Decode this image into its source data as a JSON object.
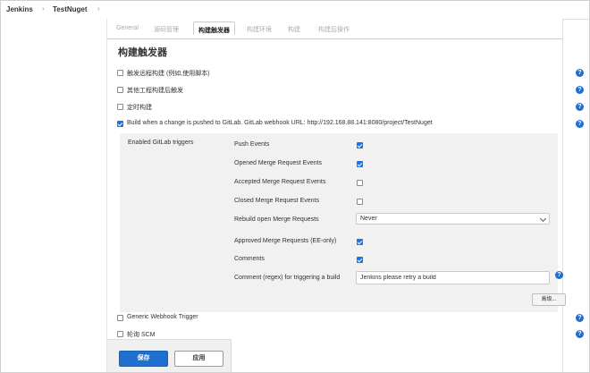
{
  "breadcrumb": {
    "items": [
      "Jenkins",
      "TestNuget"
    ],
    "separator": "›"
  },
  "tabs": [
    "General",
    "源码管理",
    "构建触发器",
    "构建环境",
    "构建",
    "构建后操作"
  ],
  "active_tab": 2,
  "section_title": "构建触发器",
  "triggers": [
    {
      "label": "触发远程构建 (例如,使用脚本)",
      "checked": false
    },
    {
      "label": "其他工程构建后触发",
      "checked": false
    },
    {
      "label": "定时构建",
      "checked": false
    },
    {
      "label": "Build when a change is pushed to GitLab. GitLab webhook URL: http://192.168.88.141:8080/project/TestNuget",
      "checked": true
    }
  ],
  "gitlab": {
    "panel_label": "Enabled GitLab triggers",
    "options": [
      {
        "label": "Push Events",
        "checked": true
      },
      {
        "label": "Opened Merge Request Events",
        "checked": true
      },
      {
        "label": "Accepted Merge Request Events",
        "checked": false
      },
      {
        "label": "Closed Merge Request Events",
        "checked": false
      }
    ],
    "rebuild_label": "Rebuild open Merge Requests",
    "rebuild_value": "Never",
    "approved_label": "Approved Merge Requests (EE-only)",
    "approved_checked": true,
    "comments_label": "Comments",
    "comments_checked": true,
    "comment_regex_label": "Comment (regex) for triggering a build",
    "comment_regex_value": "Jenkins please retry a build",
    "advanced_label": "高级..."
  },
  "more_triggers": [
    {
      "label": "Generic Webhook Trigger",
      "checked": false
    },
    {
      "label": "轮询 SCM",
      "checked": false
    }
  ],
  "buttons": {
    "save": "保存",
    "apply": "应用"
  },
  "help_glyph": "?",
  "colors": {
    "accent": "#1f6fd1",
    "checkbox": "#1a73e8"
  }
}
